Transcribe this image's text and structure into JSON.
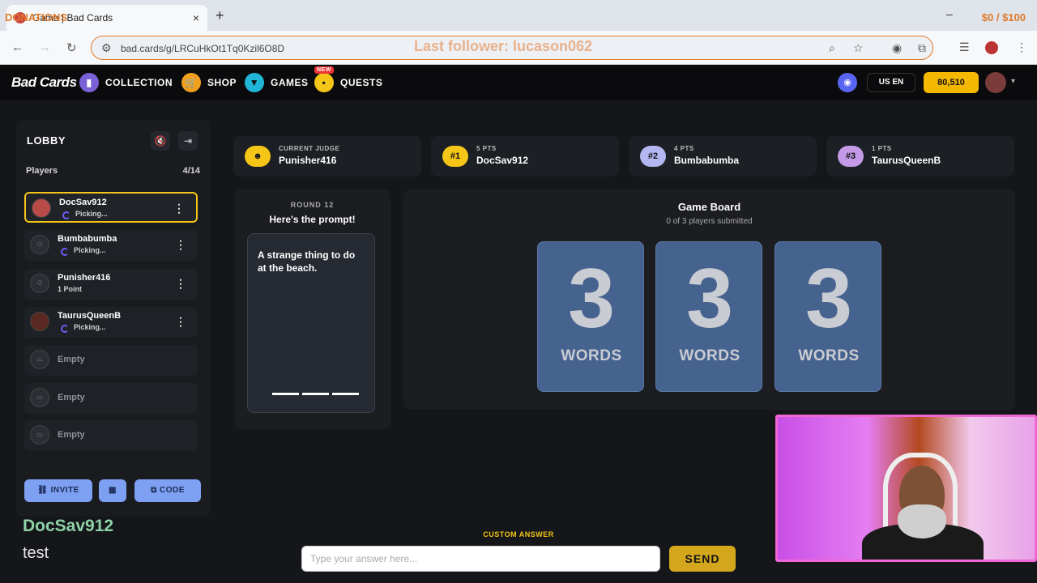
{
  "browser": {
    "tab_title": "Game | Bad Cards",
    "url": "bad.cards/g/LRCuHkOt1Tq0Kzil6O8D",
    "new_tab_label": "+",
    "close_label": "×"
  },
  "overlay": {
    "donations": "DONATIONS",
    "goal": "$0 / $100",
    "last_follower": "Last follower: lucason062"
  },
  "nav": {
    "logo": "Bad Cards",
    "items": [
      "COLLECTION",
      "SHOP",
      "GAMES",
      "QUESTS"
    ],
    "new_badge": "NEW",
    "lang": "US EN",
    "coins": "80,510"
  },
  "lobby": {
    "title": "LOBBY",
    "players_label": "Players",
    "players_count": "4/14",
    "players": [
      {
        "name": "DocSav912",
        "status": "Picking..."
      },
      {
        "name": "Bumbabumba",
        "status": "Picking..."
      },
      {
        "name": "Punisher416",
        "status": "1 Point"
      },
      {
        "name": "TaurusQueenB",
        "status": "Picking..."
      }
    ],
    "empty_label": "Empty",
    "invite": "INVITE",
    "code": "CODE"
  },
  "scores": {
    "judge_label": "CURRENT JUDGE",
    "judge_name": "Punisher416",
    "ranks": [
      {
        "rank": "#1",
        "pts": "5 PTS",
        "name": "DocSav912",
        "color": "#f5c518"
      },
      {
        "rank": "#2",
        "pts": "4 PTS",
        "name": "Bumbabumba",
        "color": "#b3b6f0"
      },
      {
        "rank": "#3",
        "pts": "1 PTS",
        "name": "TaurusQueenB",
        "color": "#c49ae8"
      }
    ]
  },
  "prompt": {
    "round": "ROUND 12",
    "heading": "Here's the prompt!",
    "text": "A strange thing to do at the beach."
  },
  "board": {
    "title": "Game Board",
    "subtitle": "0 of 3 players submitted",
    "card_number": "3",
    "card_word": "WORDS"
  },
  "chat": {
    "name": "DocSav912",
    "message": "test"
  },
  "answer": {
    "label": "CUSTOM ANSWER",
    "placeholder": "Type your answer here...",
    "send": "SEND"
  }
}
